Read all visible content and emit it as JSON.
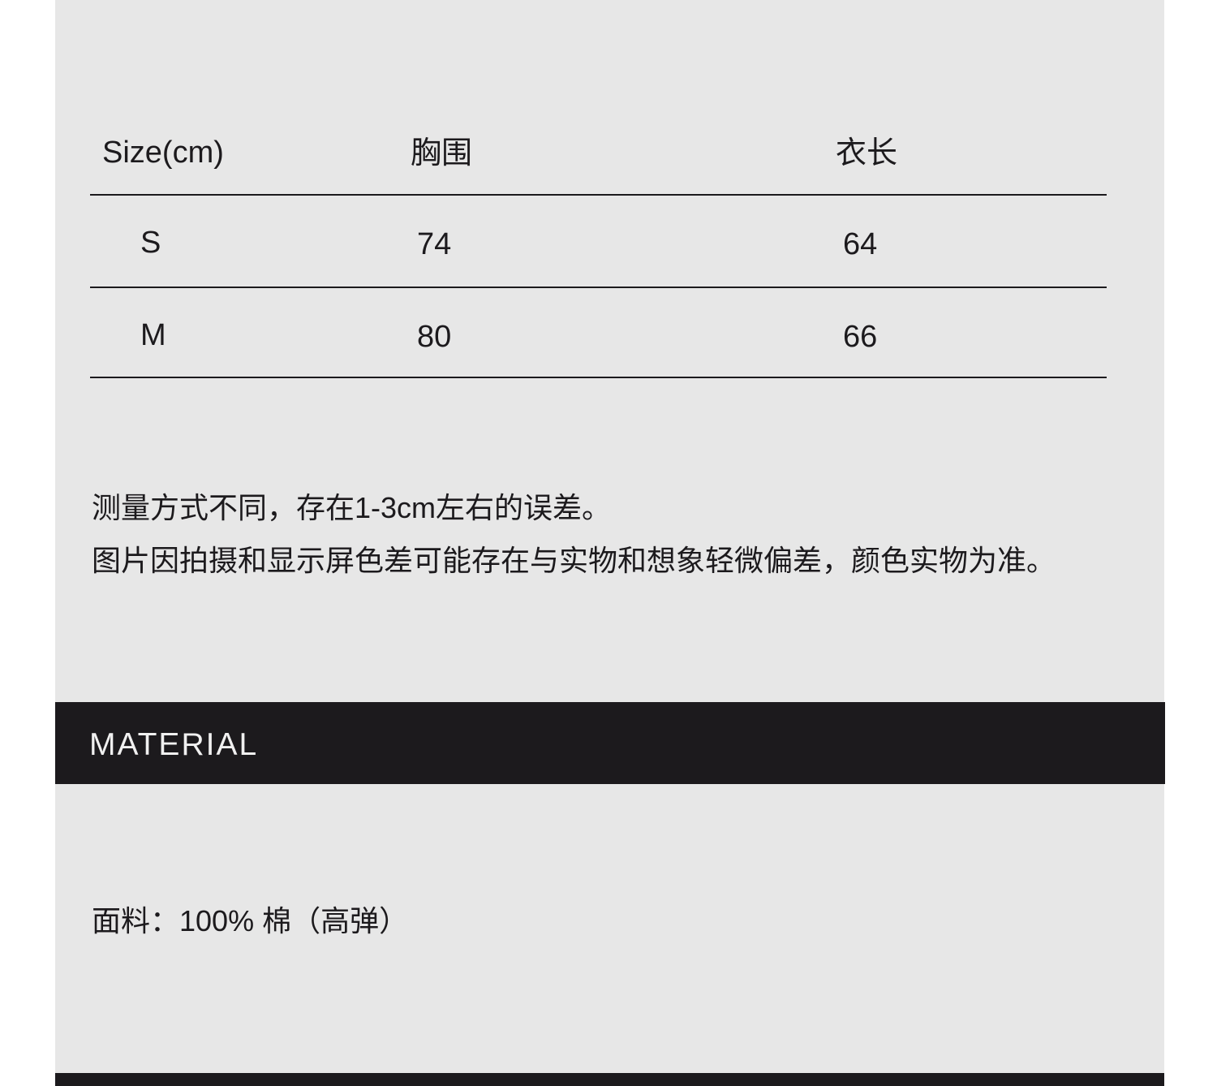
{
  "size_table": {
    "headers": [
      "Size(cm)",
      "胸围",
      "衣长"
    ],
    "rows": [
      [
        "S",
        "74",
        "64"
      ],
      [
        "M",
        "80",
        "66"
      ]
    ]
  },
  "notes": [
    "测量方式不同，存在1-3cm左右的误差。",
    "图片因拍摄和显示屏色差可能存在与实物和想象轻微偏差，颜色实物为准。"
  ],
  "material": {
    "title": "MATERIAL",
    "fabric": "面料：100% 棉（高弹）"
  },
  "colors": {
    "background_panel": "#e7e7e7",
    "dark_bar": "#1c1a1d",
    "text": "#1c1a1d",
    "title_text": "#f0f0f0"
  }
}
